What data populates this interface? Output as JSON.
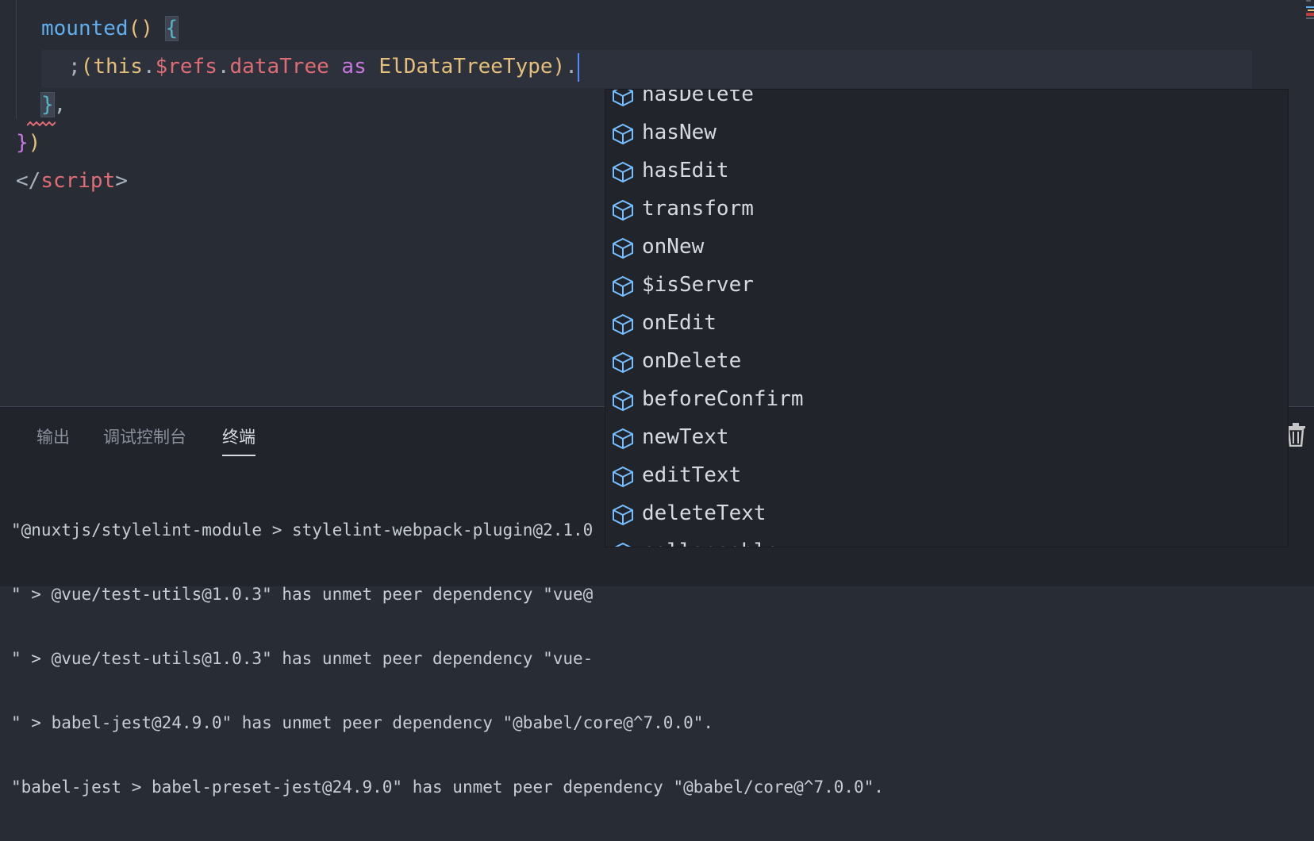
{
  "editor": {
    "lines": {
      "l1": {
        "fn": "mounted",
        "parens": "()",
        "brace": "{"
      },
      "l2": {
        "semi": ";",
        "open_paren": "(",
        "this": "this",
        "dot1": ".",
        "refs": "$refs",
        "dot2": ".",
        "dataTree": "dataTree",
        "as": "as",
        "type": "ElDataTreeType",
        "close_paren": ")",
        "dot3": "."
      },
      "l3": {
        "brace": "}",
        "comma": ","
      },
      "l4": {
        "brace": "}",
        "paren": ")"
      },
      "l5": {
        "open": "</",
        "tag": "script",
        "close": ">"
      }
    }
  },
  "suggestions": [
    {
      "label": "hasDelete",
      "icon": "cube-icon"
    },
    {
      "label": "hasNew",
      "icon": "cube-icon"
    },
    {
      "label": "hasEdit",
      "icon": "cube-icon"
    },
    {
      "label": "transform",
      "icon": "cube-icon"
    },
    {
      "label": "onNew",
      "icon": "cube-icon"
    },
    {
      "label": "$isServer",
      "icon": "cube-icon"
    },
    {
      "label": "onEdit",
      "icon": "cube-icon"
    },
    {
      "label": "onDelete",
      "icon": "cube-icon"
    },
    {
      "label": "beforeConfirm",
      "icon": "cube-icon"
    },
    {
      "label": "newText",
      "icon": "cube-icon"
    },
    {
      "label": "editText",
      "icon": "cube-icon"
    },
    {
      "label": "deleteText",
      "icon": "cube-icon"
    },
    {
      "label": "collapsable",
      "icon": "cube-icon"
    }
  ],
  "panel": {
    "tabs": {
      "output": "输出",
      "debug_console": "调试控制台",
      "terminal": "终端"
    },
    "terminal_lines": [
      "\"@nuxtjs/stylelint-module > stylelint-webpack-plugin@2.1.0",
      "\" > @vue/test-utils@1.0.3\" has unmet peer dependency \"vue@",
      "\" > @vue/test-utils@1.0.3\" has unmet peer dependency \"vue-",
      "\" > babel-jest@24.9.0\" has unmet peer dependency \"@babel/core@^7.0.0\".",
      "\"babel-jest > babel-preset-jest@24.9.0\" has unmet peer dependency \"@babel/core@^7.0.0\"."
    ]
  },
  "colors": {
    "background": "#282c34",
    "accent": "#528bff",
    "icon": "#75beff"
  }
}
